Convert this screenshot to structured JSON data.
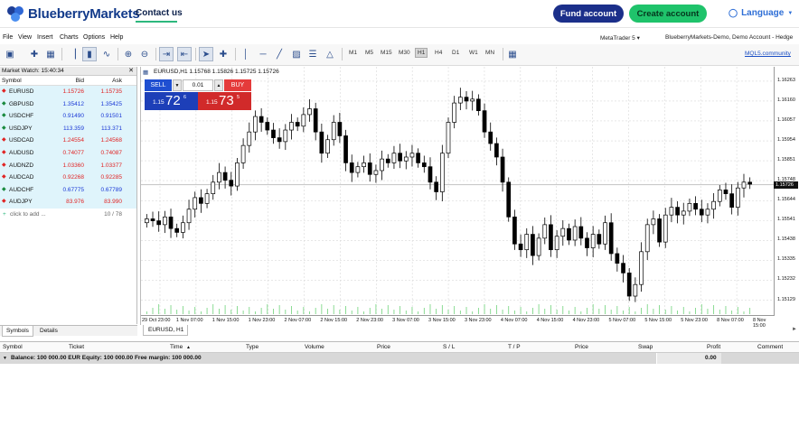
{
  "site_header": {
    "logo_text": "BlueberryMarkets",
    "contact_link": "Contact us",
    "fund_button": "Fund account",
    "create_button": "Create account",
    "language_label": "Language",
    "brand_color": "#123a8a",
    "accent_green": "#1fc36b"
  },
  "menu": {
    "items": [
      "File",
      "View",
      "Insert",
      "Charts",
      "Options",
      "Help"
    ],
    "platform_label": "MetaTrader 5",
    "account_label": "BlueberryMarkets-Demo, Demo Account - Hedge"
  },
  "toolbar": {
    "timeframes": [
      "M1",
      "M5",
      "M15",
      "M30",
      "H1",
      "H4",
      "D1",
      "W1",
      "MN"
    ],
    "active_timeframe": "H1",
    "mql_link": "MQL5.community"
  },
  "market_watch": {
    "title": "Market Watch: 15:40:34",
    "col_symbol": "Symbol",
    "col_bid": "Bid",
    "col_ask": "Ask",
    "rows": [
      {
        "symbol": "EURUSD",
        "bid": "1.15726",
        "ask": "1.15735",
        "dir": "down"
      },
      {
        "symbol": "GBPUSD",
        "bid": "1.35412",
        "ask": "1.35425",
        "dir": "up"
      },
      {
        "symbol": "USDCHF",
        "bid": "0.91490",
        "ask": "0.91501",
        "dir": "up"
      },
      {
        "symbol": "USDJPY",
        "bid": "113.359",
        "ask": "113.371",
        "dir": "up"
      },
      {
        "symbol": "USDCAD",
        "bid": "1.24554",
        "ask": "1.24568",
        "dir": "down"
      },
      {
        "symbol": "AUDUSD",
        "bid": "0.74077",
        "ask": "0.74087",
        "dir": "down"
      },
      {
        "symbol": "AUDNZD",
        "bid": "1.03360",
        "ask": "1.03377",
        "dir": "down"
      },
      {
        "symbol": "AUDCAD",
        "bid": "0.92268",
        "ask": "0.92285",
        "dir": "down"
      },
      {
        "symbol": "AUDCHF",
        "bid": "0.67775",
        "ask": "0.67789",
        "dir": "up"
      },
      {
        "symbol": "AUDJPY",
        "bid": "83.976",
        "ask": "83.990",
        "dir": "down"
      }
    ],
    "add_label": "click to add ...",
    "count_label": "10 / 78",
    "tabs": [
      "Symbols",
      "Details"
    ]
  },
  "chart": {
    "title": "EURUSD,H1  1.15768 1.15826 1.15725 1.15726",
    "tab_label": "EURUSD, H1",
    "trade": {
      "sell_label": "SELL",
      "buy_label": "BUY",
      "volume": "0.01",
      "sell_small": "1.15",
      "sell_big": "72",
      "sell_sup": "6",
      "buy_small": "1.15",
      "buy_big": "73",
      "buy_sup": "5"
    },
    "current_price": "1.15726",
    "price_ticks": [
      "1.16263",
      "1.16160",
      "1.16057",
      "1.15954",
      "1.15851",
      "1.15748",
      "1.15644",
      "1.15541",
      "1.15438",
      "1.15335",
      "1.15232",
      "1.15129"
    ],
    "time_ticks": [
      "29 Oct 23:00",
      "1 Nov 07:00",
      "1 Nov 15:00",
      "1 Nov 23:00",
      "2 Nov 07:00",
      "2 Nov 15:00",
      "2 Nov 23:00",
      "3 Nov 07:00",
      "3 Nov 15:00",
      "3 Nov 23:00",
      "4 Nov 07:00",
      "4 Nov 15:00",
      "4 Nov 23:00",
      "5 Nov 07:00",
      "5 Nov 15:00",
      "5 Nov 23:00",
      "8 Nov 07:00",
      "8 Nov 15:00"
    ]
  },
  "chart_data": {
    "type": "candlestick",
    "symbol": "EURUSD",
    "timeframe": "H1",
    "ylim": [
      1.1508,
      1.163
    ],
    "close_series": [
      1.1555,
      1.1554,
      1.1552,
      1.1556,
      1.155,
      1.1548,
      1.1553,
      1.156,
      1.1566,
      1.1563,
      1.1568,
      1.1574,
      1.1579,
      1.1575,
      1.1572,
      1.1584,
      1.1593,
      1.16,
      1.1608,
      1.1605,
      1.1601,
      1.1597,
      1.1595,
      1.1601,
      1.1605,
      1.1603,
      1.1609,
      1.1612,
      1.16,
      1.1589,
      1.1596,
      1.1605,
      1.1598,
      1.1584,
      1.1579,
      1.1582,
      1.1584,
      1.1578,
      1.158,
      1.1586,
      1.1584,
      1.1589,
      1.1585,
      1.1587,
      1.1589,
      1.1584,
      1.1582,
      1.1574,
      1.1569,
      1.1589,
      1.1605,
      1.1615,
      1.1618,
      1.1616,
      1.1617,
      1.1611,
      1.16,
      1.1594,
      1.1587,
      1.1574,
      1.1556,
      1.1542,
      1.1539,
      1.1547,
      1.1536,
      1.1545,
      1.1552,
      1.1539,
      1.1546,
      1.155,
      1.1544,
      1.1551,
      1.1545,
      1.154,
      1.1547,
      1.1542,
      1.1553,
      1.1537,
      1.1532,
      1.1527,
      1.1515,
      1.1521,
      1.1538,
      1.1552,
      1.1555,
      1.1543,
      1.1557,
      1.1561,
      1.1557,
      1.1559,
      1.1563,
      1.156,
      1.1557,
      1.156,
      1.1564,
      1.157,
      1.1568,
      1.1561,
      1.1571,
      1.1574,
      1.1573
    ]
  },
  "terminal": {
    "columns": [
      "Symbol",
      "Ticket",
      "Time",
      "Type",
      "Volume",
      "Price",
      "S / L",
      "T / P",
      "Price",
      "Swap",
      "Profit",
      "Comment"
    ],
    "balance_text": "Balance: 100 000.00 EUR  Equity: 100 000.00  Free margin: 100 000.00",
    "profit_total": "0.00"
  }
}
